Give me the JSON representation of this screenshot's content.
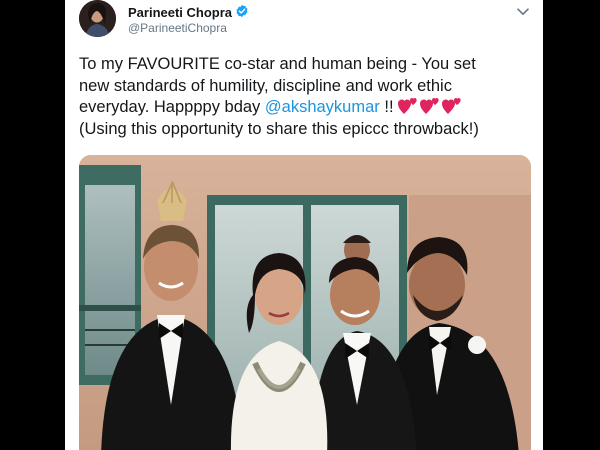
{
  "tweet": {
    "author_name": "Parineeti Chopra",
    "author_handle": "@ParineetiChopra",
    "verified": true,
    "text_lines": [
      "To my FAVOURITE co-star and human being - You set",
      "new standards of humility, discipline and work ethic",
      "everyday. Happppy bday",
      "(Using this opportunity to share this epiccc throwback!)"
    ],
    "mention": "@akshaykumar",
    "after_mention": " !!",
    "emoji": [
      "two-hearts",
      "two-hearts",
      "two-hearts"
    ]
  },
  "colors": {
    "text": "#14171a",
    "secondary_text": "#657786",
    "link": "#1b95e0",
    "verified_badge": "#1da1f2",
    "heart": "#e0245e",
    "page_background": "#000000"
  },
  "icons": {
    "verified": "verified-badge-icon",
    "menu": "chevron-down-icon"
  }
}
